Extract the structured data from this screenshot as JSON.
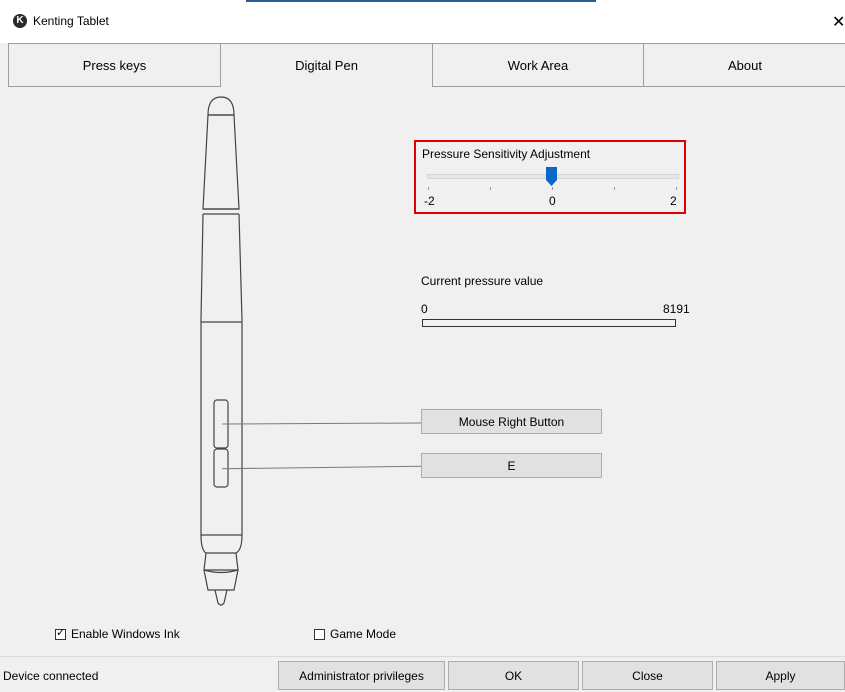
{
  "window": {
    "title": "Kenting Tablet",
    "icon": "K",
    "close_glyph": "✕"
  },
  "tabs": [
    {
      "label": "Press keys",
      "active": false
    },
    {
      "label": "Digital Pen",
      "active": true
    },
    {
      "label": "Work Area",
      "active": false
    },
    {
      "label": "About",
      "active": false
    }
  ],
  "pressure_sensitivity": {
    "label": "Pressure Sensitivity Adjustment",
    "min_label": "-2",
    "mid_label": "0",
    "max_label": "2",
    "value": 0,
    "highlight_color": "#e00000"
  },
  "current_pressure": {
    "label": "Current pressure value",
    "min": "0",
    "max": "8191",
    "fraction": 0
  },
  "pen_buttons": {
    "upper": "Mouse Right Button",
    "lower": "E"
  },
  "options": {
    "windows_ink": {
      "label": "Enable Windows Ink",
      "checked": true
    },
    "game_mode": {
      "label": "Game Mode",
      "checked": false
    }
  },
  "status": {
    "text": "Device connected"
  },
  "buttons": {
    "admin": "Administrator privileges",
    "ok": "OK",
    "close": "Close",
    "apply": "Apply"
  }
}
